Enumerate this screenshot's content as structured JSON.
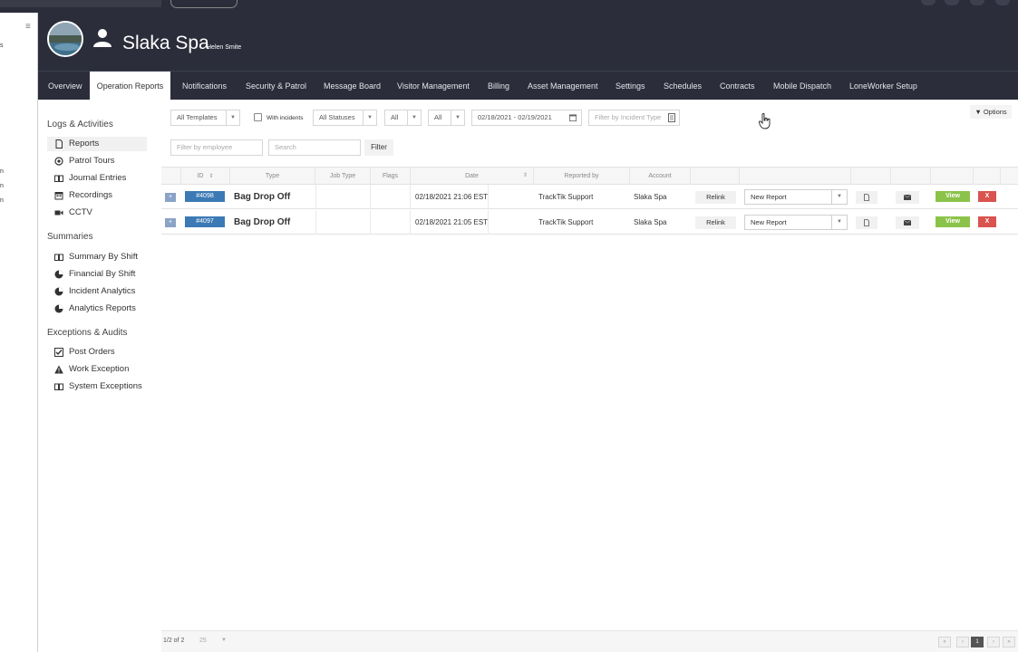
{
  "app": {
    "title": "Slaka Spa",
    "user": "Helen Smite"
  },
  "nav": {
    "tabs": [
      "Overview",
      "Operation Reports",
      "Notifications",
      "Security & Patrol",
      "Message Board",
      "Visitor Management",
      "Billing",
      "Asset Management",
      "Settings",
      "Schedules",
      "Contracts",
      "Mobile Dispatch",
      "LoneWorker Setup"
    ],
    "active": "Operation Reports"
  },
  "sidebar": {
    "logs_title": "Logs & Activities",
    "logs": [
      {
        "label": "Reports",
        "icon": "file-icon"
      },
      {
        "label": "Patrol Tours",
        "icon": "target-icon"
      },
      {
        "label": "Journal Entries",
        "icon": "book-icon"
      },
      {
        "label": "Recordings",
        "icon": "calendar-icon"
      },
      {
        "label": "CCTV",
        "icon": "video-camera-icon"
      }
    ],
    "summaries_title": "Summaries",
    "summaries": [
      {
        "label": "Summary By Shift",
        "icon": "book-icon"
      },
      {
        "label": "Financial By Shift",
        "icon": "pie-chart-icon"
      },
      {
        "label": "Incident Analytics",
        "icon": "pie-chart-icon"
      },
      {
        "label": "Analytics Reports",
        "icon": "pie-chart-icon"
      }
    ],
    "exceptions_title": "Exceptions & Audits",
    "exceptions": [
      {
        "label": "Post Orders",
        "icon": "checkbox-icon"
      },
      {
        "label": "Work Exception",
        "icon": "warning-icon"
      },
      {
        "label": "System Exceptions",
        "icon": "book-icon"
      }
    ]
  },
  "filters": {
    "templates": "All Templates",
    "with_incidents": "With incidents",
    "statuses": "All Statuses",
    "all_1": "All",
    "all_2": "All",
    "date_range": "02/18/2021 - 02/19/2021",
    "incident_type_placeholder": "Filter by Incident Type",
    "employee_placeholder": "Filter by employee",
    "search_placeholder": "Search",
    "filter_button": "Filter",
    "options": "Options"
  },
  "table": {
    "columns": [
      "ID",
      "Type",
      "Job Type",
      "Flags",
      "Date",
      "Reported by",
      "Account"
    ],
    "rows": [
      {
        "id": "#4098",
        "type": "Bag Drop Off",
        "job_type": "",
        "date": "02/18/2021 21:06 EST",
        "reported_by": "TrackTik Support",
        "account": "Slaka Spa",
        "relink": "Relink",
        "report_select": "New Report",
        "view": "View",
        "delete": "X"
      },
      {
        "id": "#4097",
        "type": "Bag Drop Off",
        "job_type": "",
        "date": "02/18/2021 21:05 EST",
        "reported_by": "TrackTik Support",
        "account": "Slaka Spa",
        "relink": "Relink",
        "report_select": "New Report",
        "view": "View",
        "delete": "X"
      }
    ]
  },
  "footer": {
    "page_info": "1/2 of 2",
    "per_page": "25",
    "current_page": "1"
  },
  "left_fragments": [
    "s",
    "n",
    "n",
    "n"
  ],
  "colors": {
    "header_bg": "#2b2d3a",
    "id_badge": "#3c7ab5",
    "view_button": "#8bc34a",
    "delete_button": "#d9534f"
  }
}
